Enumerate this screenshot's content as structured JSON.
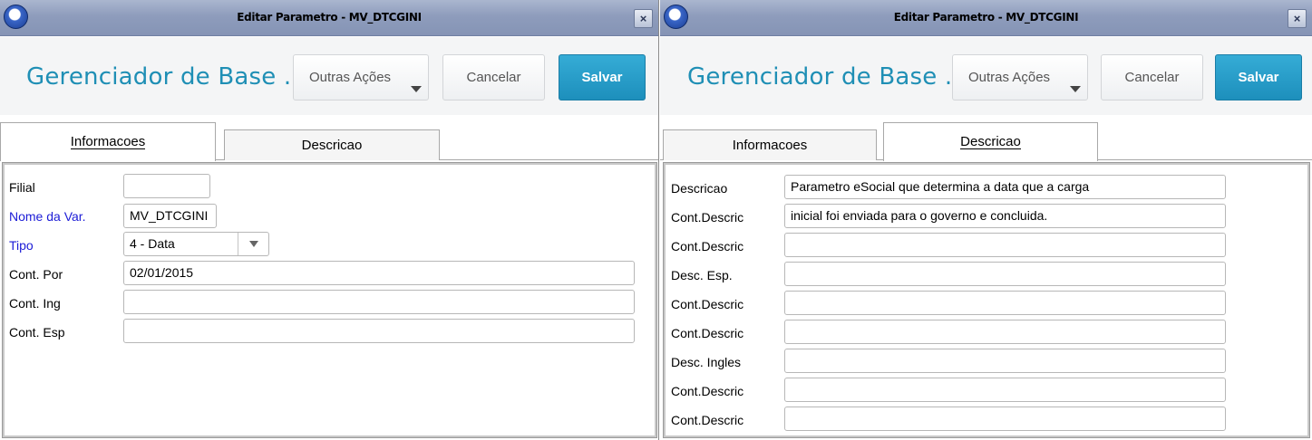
{
  "left_window": {
    "title": "Editar Parametro - MV_DTCGINI",
    "close_label": "×",
    "brand": "Gerenciador de Base ...",
    "more_actions_label": "Outras Ações",
    "cancel_label": "Cancelar",
    "save_label": "Salvar",
    "tabs": [
      {
        "label": "Informacoes",
        "active": true
      },
      {
        "label": "Descricao",
        "active": false
      }
    ],
    "fields": [
      {
        "label": "Filial",
        "value": ""
      },
      {
        "label": "Nome da Var.",
        "value": "MV_DTCGINI"
      },
      {
        "label": "Tipo",
        "value": "4 - Data"
      },
      {
        "label": "Cont. Por",
        "value": "02/01/2015"
      },
      {
        "label": "Cont. Ing",
        "value": ""
      },
      {
        "label": "Cont. Esp",
        "value": ""
      }
    ]
  },
  "right_window": {
    "title": "Editar Parametro - MV_DTCGINI",
    "close_label": "×",
    "brand": "Gerenciador de Base ...",
    "more_actions_label": "Outras Ações",
    "cancel_label": "Cancelar",
    "save_label": "Salvar",
    "tabs": [
      {
        "label": "Informacoes",
        "active": false
      },
      {
        "label": "Descricao",
        "active": true
      }
    ],
    "fields": [
      {
        "label": "Descricao",
        "value": "Parametro eSocial que determina a data que a carga"
      },
      {
        "label": "Cont.Descric",
        "value": "inicial foi enviada para o governo e concluida."
      },
      {
        "label": "Cont.Descric",
        "value": ""
      },
      {
        "label": "Desc. Esp.",
        "value": ""
      },
      {
        "label": "Cont.Descric",
        "value": ""
      },
      {
        "label": "Cont.Descric",
        "value": ""
      },
      {
        "label": "Desc. Ingles",
        "value": ""
      },
      {
        "label": "Cont.Descric",
        "value": ""
      },
      {
        "label": "Cont.Descric",
        "value": ""
      }
    ]
  },
  "colors": {
    "brand": "#1f8fb5",
    "save_button": "#2a9fcb",
    "required_label": "#1b1bd6",
    "titlebar": "#8e9cbc"
  },
  "icons": {
    "app": "globe-app-icon",
    "close": "close-icon",
    "dropdown": "chevron-down-icon"
  }
}
